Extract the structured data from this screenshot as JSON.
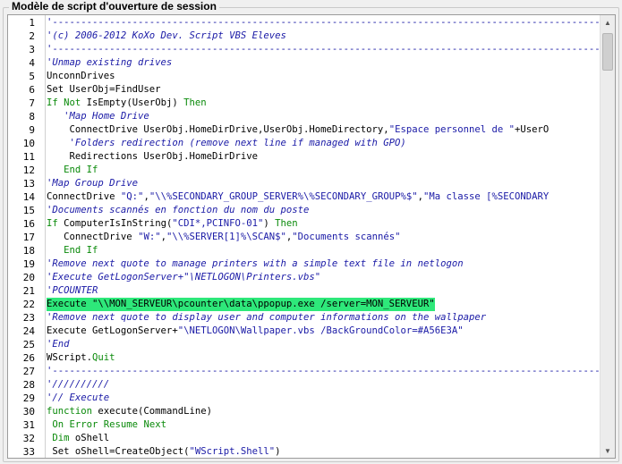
{
  "group_title": "Modèle de script d'ouverture de session",
  "lines": [
    {
      "n": "1",
      "parts": [
        {
          "t": "'----------------------------------------------------------------------------------------------------------",
          "c": "dash"
        }
      ]
    },
    {
      "n": "2",
      "parts": [
        {
          "t": "'(c) 2006-2012 KoXo Dev. Script VBS Eleves",
          "c": "c"
        }
      ]
    },
    {
      "n": "3",
      "parts": [
        {
          "t": "'----------------------------------------------------------------------------------------------------------",
          "c": "dash"
        }
      ]
    },
    {
      "n": "4",
      "parts": [
        {
          "t": "'Unmap existing drives",
          "c": "c"
        }
      ]
    },
    {
      "n": "5",
      "parts": [
        {
          "t": "UnconnDrives",
          "c": "i"
        }
      ]
    },
    {
      "n": "6",
      "parts": [
        {
          "t": "Set UserObj=FindUser",
          "c": "i"
        }
      ]
    },
    {
      "n": "7",
      "parts": [
        {
          "t": "If Not ",
          "c": "k"
        },
        {
          "t": "IsEmpty",
          "c": "i"
        },
        {
          "t": "(",
          "c": "i"
        },
        {
          "t": "UserObj",
          "c": "i"
        },
        {
          "t": ") ",
          "c": "i"
        },
        {
          "t": "Then",
          "c": "k"
        }
      ]
    },
    {
      "n": "8",
      "parts": [
        {
          "t": "   'Map Home Drive",
          "c": "c"
        }
      ]
    },
    {
      "n": "9",
      "parts": [
        {
          "t": "    ConnectDrive UserObj.HomeDirDrive,UserObj.HomeDirectory,",
          "c": "i"
        },
        {
          "t": "\"Espace personnel de \"",
          "c": "s"
        },
        {
          "t": "+UserO",
          "c": "i"
        }
      ]
    },
    {
      "n": "10",
      "parts": [
        {
          "t": "    'Folders redirection (remove next line if managed with GPO)",
          "c": "c"
        }
      ]
    },
    {
      "n": "11",
      "parts": [
        {
          "t": "    Redirections UserObj.HomeDirDrive",
          "c": "i"
        }
      ]
    },
    {
      "n": "12",
      "parts": [
        {
          "t": "   End If",
          "c": "k"
        }
      ]
    },
    {
      "n": "13",
      "parts": [
        {
          "t": "'Map Group Drive",
          "c": "c"
        }
      ]
    },
    {
      "n": "14",
      "parts": [
        {
          "t": "ConnectDrive ",
          "c": "i"
        },
        {
          "t": "\"Q:\"",
          "c": "s"
        },
        {
          "t": ",",
          "c": "i"
        },
        {
          "t": "\"\\\\%SECONDARY_GROUP_SERVER%\\%SECONDARY_GROUP%$\"",
          "c": "s"
        },
        {
          "t": ",",
          "c": "i"
        },
        {
          "t": "\"Ma classe [%SECONDARY",
          "c": "s"
        }
      ]
    },
    {
      "n": "15",
      "parts": [
        {
          "t": "'Documents scannés en fonction du nom du poste",
          "c": "c"
        }
      ]
    },
    {
      "n": "16",
      "parts": [
        {
          "t": "If ",
          "c": "k"
        },
        {
          "t": "ComputerIsInString(",
          "c": "i"
        },
        {
          "t": "\"CDI*,PCINFO-01\"",
          "c": "s"
        },
        {
          "t": ") ",
          "c": "i"
        },
        {
          "t": "Then",
          "c": "k"
        }
      ]
    },
    {
      "n": "17",
      "parts": [
        {
          "t": "   ConnectDrive ",
          "c": "i"
        },
        {
          "t": "\"W:\"",
          "c": "s"
        },
        {
          "t": ",",
          "c": "i"
        },
        {
          "t": "\"\\\\%SERVER[1]%\\SCAN$\"",
          "c": "s"
        },
        {
          "t": ",",
          "c": "i"
        },
        {
          "t": "\"Documents scannés\"",
          "c": "s"
        }
      ]
    },
    {
      "n": "18",
      "parts": [
        {
          "t": "   End If",
          "c": "k"
        }
      ]
    },
    {
      "n": "19",
      "parts": [
        {
          "t": "'Remove next quote to manage printers with a simple text file in netlogon",
          "c": "c"
        }
      ]
    },
    {
      "n": "20",
      "parts": [
        {
          "t": "'Execute GetLogonServer+\"\\NETLOGON\\Printers.vbs\"",
          "c": "c"
        }
      ]
    },
    {
      "n": "21",
      "parts": [
        {
          "t": "'PCOUNTER",
          "c": "c"
        }
      ]
    },
    {
      "n": "22",
      "hl": true,
      "parts": [
        {
          "t": "Execute \"\\\\MON_SERVEUR\\pcounter\\data\\ppopup.exe /server=MON_SERVEUR\"",
          "c": "i"
        }
      ]
    },
    {
      "n": "23",
      "parts": [
        {
          "t": "'Remove next quote to display user and computer informations on the wallpaper",
          "c": "c"
        }
      ]
    },
    {
      "n": "24",
      "parts": [
        {
          "t": "Execute GetLogonServer+",
          "c": "i"
        },
        {
          "t": "\"\\NETLOGON\\Wallpaper.vbs /BackGroundColor=#A56E3A\"",
          "c": "s"
        }
      ]
    },
    {
      "n": "25",
      "parts": [
        {
          "t": "'End",
          "c": "c"
        }
      ]
    },
    {
      "n": "26",
      "parts": [
        {
          "t": "WScript.",
          "c": "i"
        },
        {
          "t": "Quit",
          "c": "k"
        }
      ]
    },
    {
      "n": "27",
      "parts": [
        {
          "t": "'----------------------------------------------------------------------------------------------------------",
          "c": "dash"
        }
      ]
    },
    {
      "n": "28",
      "parts": [
        {
          "t": "'//////////",
          "c": "c"
        }
      ]
    },
    {
      "n": "29",
      "parts": [
        {
          "t": "'// Execute",
          "c": "c"
        }
      ]
    },
    {
      "n": "30",
      "parts": [
        {
          "t": "function ",
          "c": "k"
        },
        {
          "t": "execute(CommandLine)",
          "c": "i"
        }
      ]
    },
    {
      "n": "31",
      "parts": [
        {
          "t": " On Error Resume ",
          "c": "k"
        },
        {
          "t": "Next",
          "c": "k"
        }
      ]
    },
    {
      "n": "32",
      "parts": [
        {
          "t": " Dim ",
          "c": "k"
        },
        {
          "t": "oShell",
          "c": "i"
        }
      ]
    },
    {
      "n": "33",
      "parts": [
        {
          "t": " Set oShell=CreateObject(",
          "c": "i"
        },
        {
          "t": "\"WScript.Shell\"",
          "c": "s"
        },
        {
          "t": ")",
          "c": "i"
        }
      ]
    }
  ],
  "scrollbar": {
    "up_icon": "triangle-up",
    "down_icon": "triangle-down"
  }
}
